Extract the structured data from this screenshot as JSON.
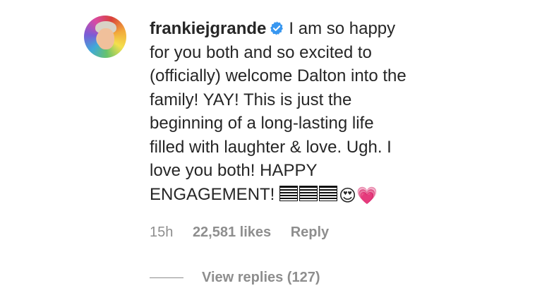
{
  "comment": {
    "username": "frankiejgrande",
    "verified": true,
    "lines": [
      "I am so happy",
      "for you both and so excited to",
      "(officially) welcome Dalton into the",
      "family! YAY! This is just the",
      "beginning of a long-lasting life",
      "filled with laughter & love. Ugh. I",
      "love you both! HAPPY",
      "ENGAGEMENT!"
    ],
    "emojis": [
      "😍",
      "💗"
    ],
    "timestamp": "15h",
    "likes": "22,581 likes",
    "reply_label": "Reply",
    "view_replies": "View replies (127)"
  },
  "colors": {
    "text": "#262626",
    "muted": "#8e8e8e",
    "verified": "#3897f0"
  }
}
